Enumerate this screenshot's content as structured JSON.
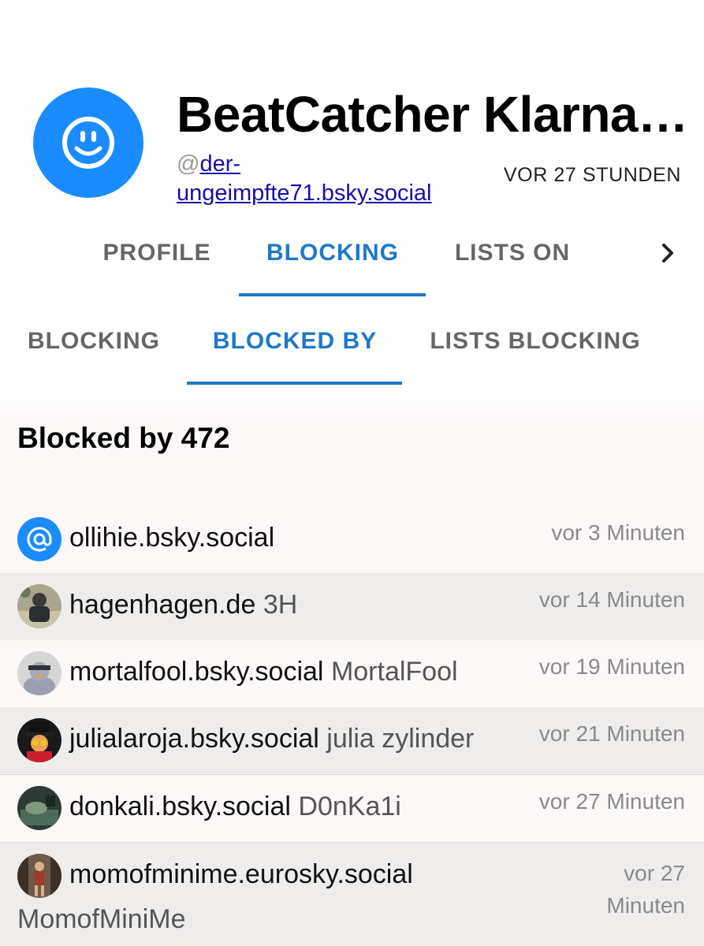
{
  "profile": {
    "title": "BeatCatcher Klarna…",
    "handle_prefix": "@",
    "handle_link": "der-ungeimpfte71.bsky.social",
    "posted": "VOR 27 STUNDEN",
    "avatar_icon": "smiley-icon",
    "avatar_color": "#1a8cff"
  },
  "main_tabs": [
    {
      "label": "PROFILE"
    },
    {
      "label": "BLOCKING",
      "active": true
    },
    {
      "label": "LISTS ON"
    }
  ],
  "sub_tabs": [
    {
      "label": "BLOCKING"
    },
    {
      "label": "BLOCKED BY",
      "active": true
    },
    {
      "label": "LISTS BLOCKING"
    }
  ],
  "blocked_by": {
    "heading": "Blocked by 472",
    "rows": [
      {
        "handle": "ollihie.bsky.social",
        "display": "",
        "time": "vor 3 Minuten"
      },
      {
        "handle": "hagenhagen.de",
        "display": "3H",
        "time": "vor 14 Minuten"
      },
      {
        "handle": "mortalfool.bsky.social",
        "display": "MortalFool",
        "time": "vor 19 Minuten"
      },
      {
        "handle": "julialaroja.bsky.social",
        "display": "julia zylinder",
        "time": "vor 21 Minuten"
      },
      {
        "handle": "donkali.bsky.social",
        "display": "D0nKa1i",
        "time": "vor 27 Minuten"
      },
      {
        "handle": "momofminime.eurosky.social",
        "display": "MomofMiniMe",
        "time_line1": "vor 27",
        "time_line2": "Minuten"
      }
    ]
  },
  "colors": {
    "accent": "#1e78c8",
    "link": "#1a0dab"
  }
}
